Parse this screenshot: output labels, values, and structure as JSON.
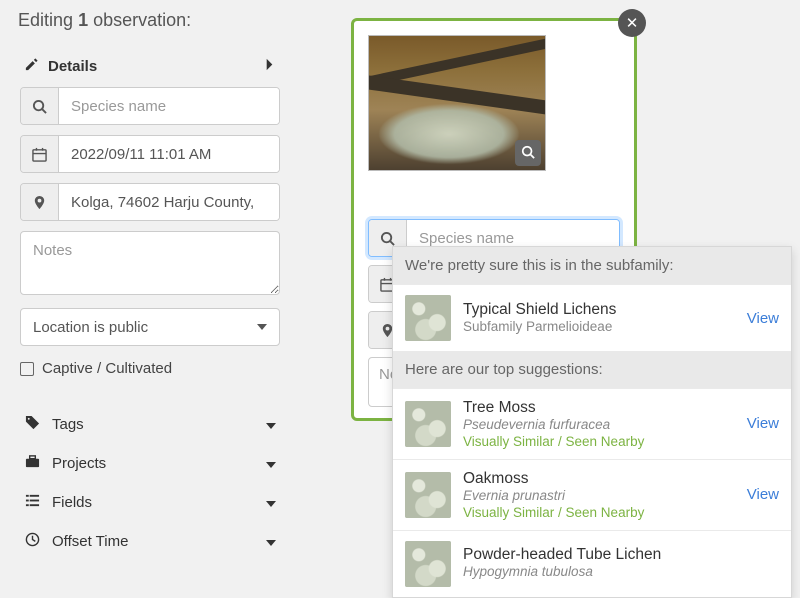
{
  "header": {
    "prefix": "Editing",
    "count": "1",
    "suffix": "observation:"
  },
  "details": {
    "title": "Details",
    "species_placeholder": "Species name",
    "date_value": "2022/09/11 11:01 AM",
    "location_value": "Kolga, 74602 Harju County,",
    "notes_placeholder": "Notes",
    "geoprivacy": "Location is public",
    "captive_label": "Captive / Cultivated"
  },
  "accordion": {
    "tags": "Tags",
    "projects": "Projects",
    "fields": "Fields",
    "offset": "Offset Time"
  },
  "obs": {
    "species_placeholder": "Species name",
    "notes_placeholder": "Note"
  },
  "suggestions": {
    "confident_label": "We're pretty sure this is in the subfamily:",
    "top_label": "Here are our top suggestions:",
    "view": "View",
    "confident": {
      "name": "Typical Shield Lichens",
      "sub": "Subfamily Parmelioideae"
    },
    "items": [
      {
        "name": "Tree Moss",
        "sub": "Pseudevernia furfuracea",
        "hint": "Visually Similar / Seen Nearby"
      },
      {
        "name": "Oakmoss",
        "sub": "Evernia prunastri",
        "hint": "Visually Similar / Seen Nearby"
      },
      {
        "name": "Powder-headed Tube Lichen",
        "sub": "Hypogymnia tubulosa",
        "hint": ""
      }
    ]
  }
}
